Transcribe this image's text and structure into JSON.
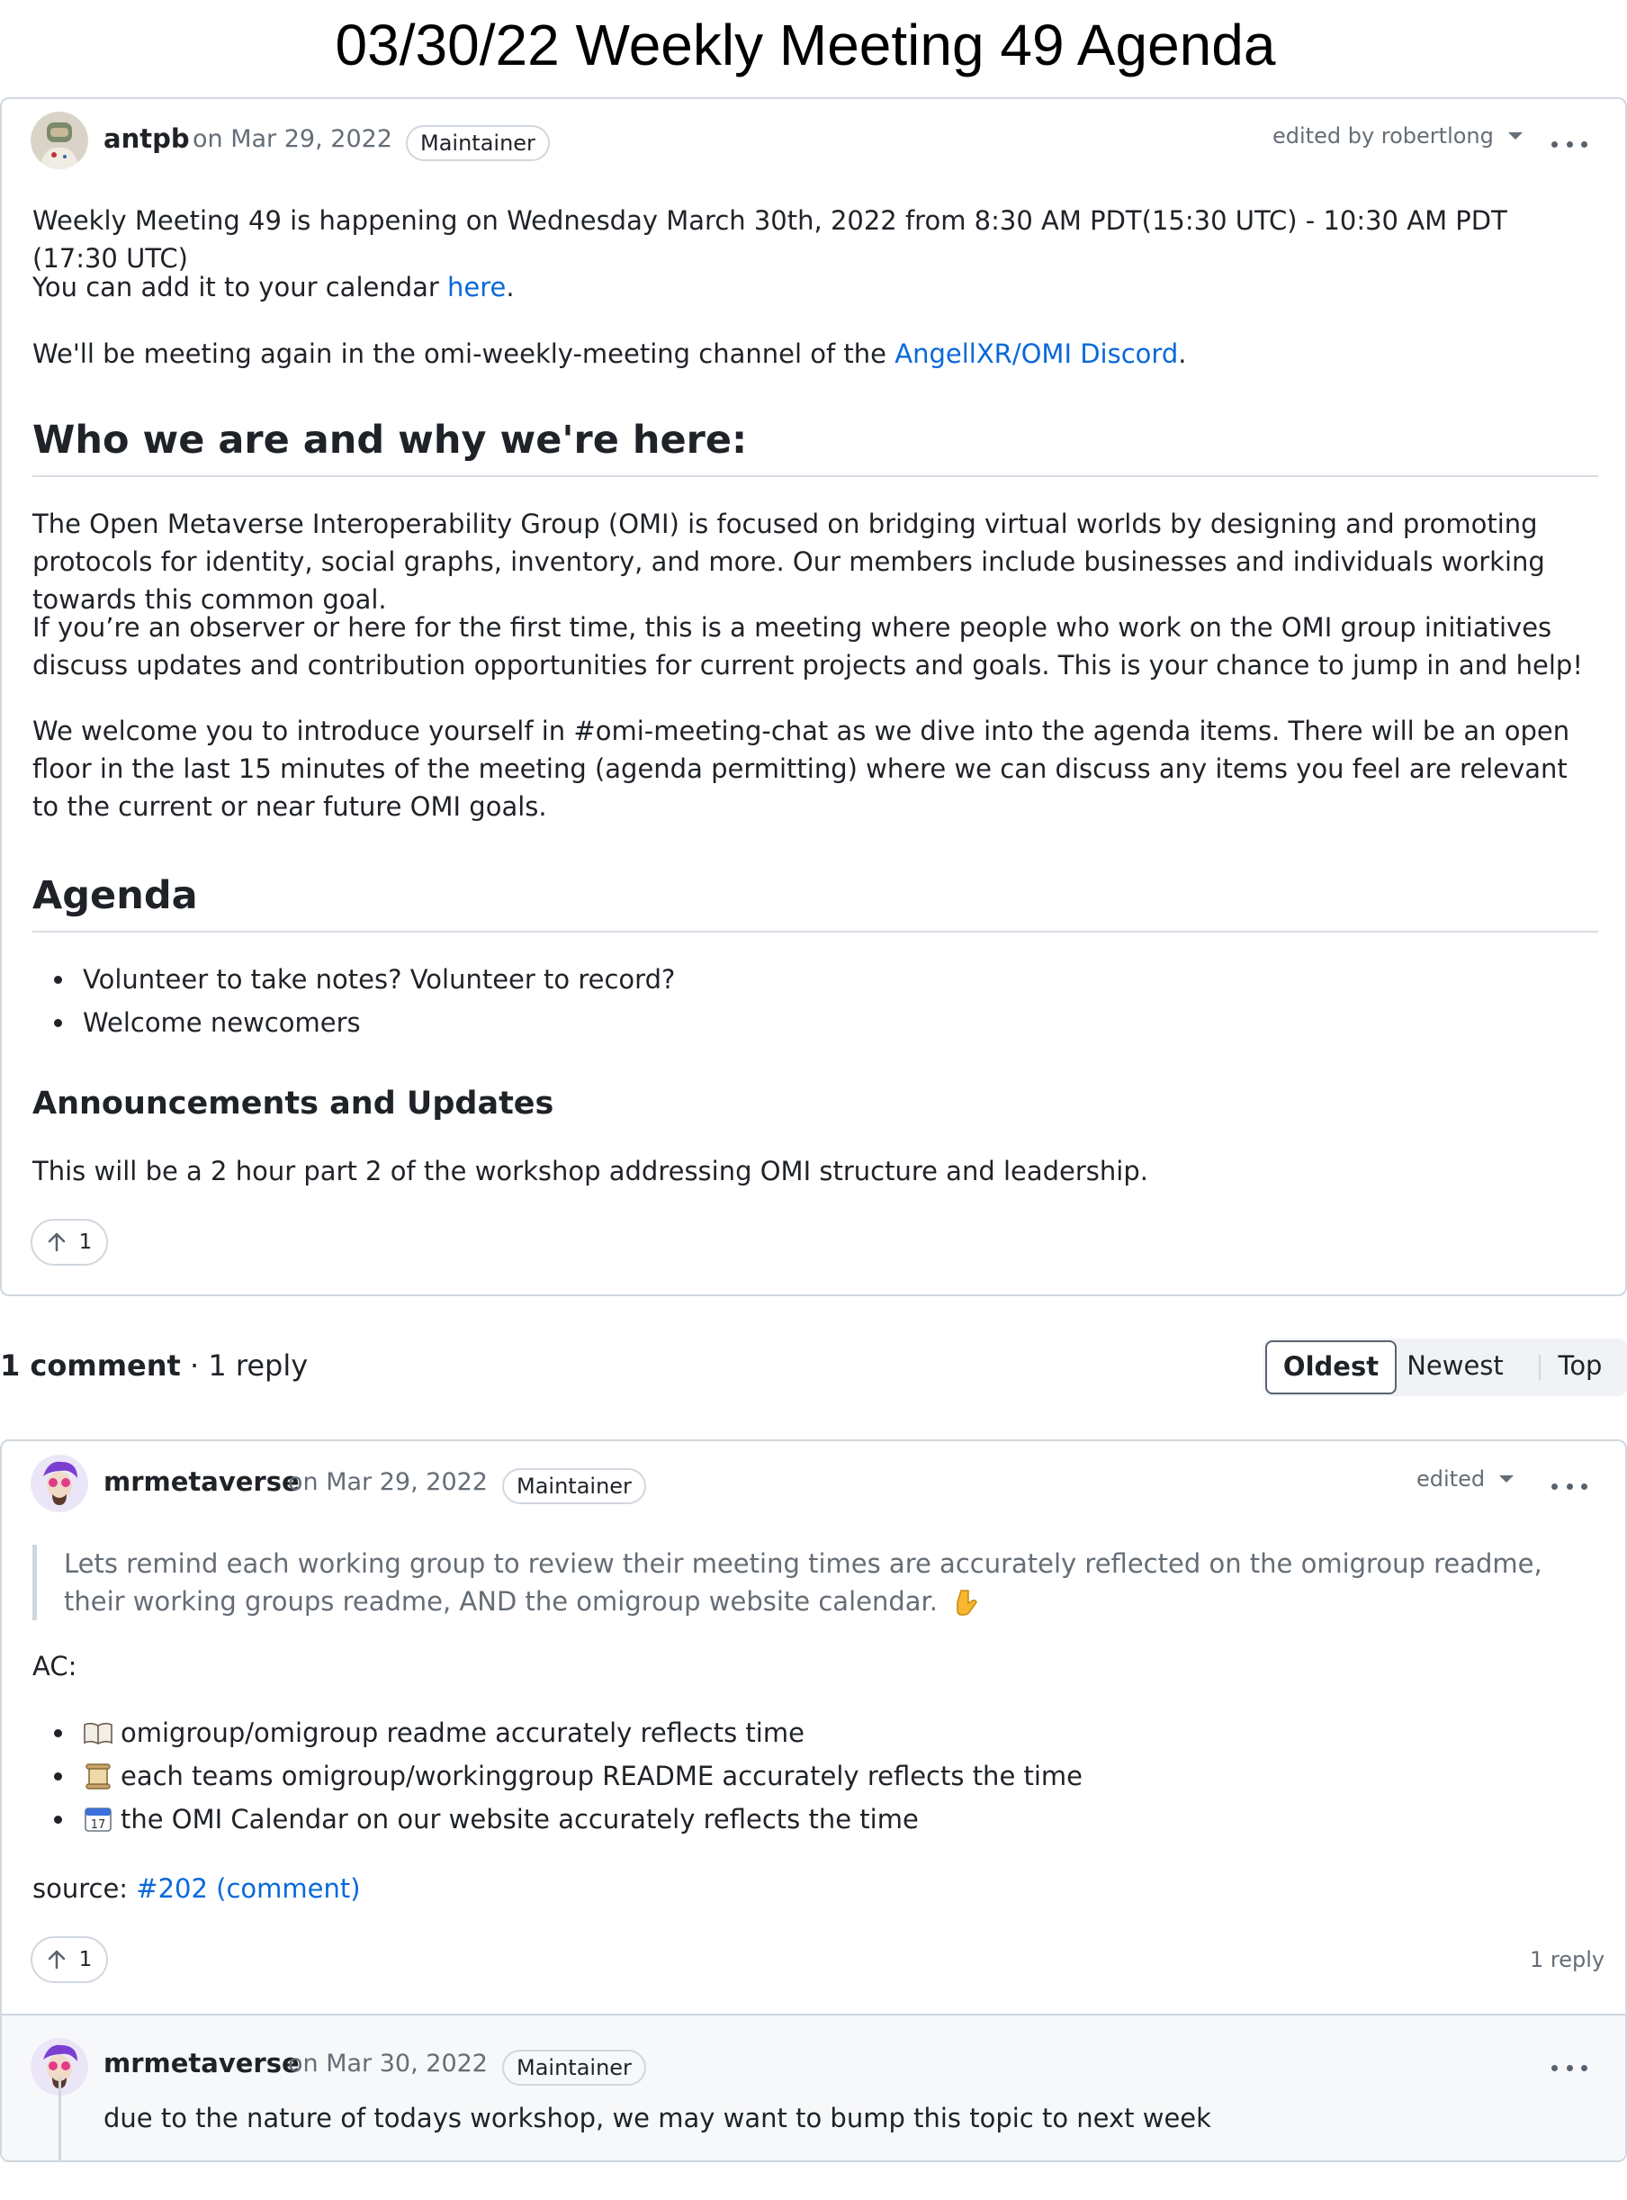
{
  "page": {
    "title": "03/30/22 Weekly Meeting 49 Agenda"
  },
  "post": {
    "author": "antpb",
    "date": "on Mar 29, 2022",
    "badge": "Maintainer",
    "edited_by": "edited by robertlong",
    "line1": "Weekly Meeting 49 is happening on Wednesday March 30th, 2022 from 8:30 AM PDT(15:30 UTC) - 10:30 AM PDT (17:30 UTC)",
    "calendar_prefix": "You can add it to your calendar ",
    "calendar_link": "here",
    "calendar_suffix": ".",
    "discord_prefix": "We'll be meeting again in the omi-weekly-meeting channel of the ",
    "discord_link": "AngellXR/OMI Discord",
    "discord_suffix": ".",
    "who_heading": "Who we are and why we're here:",
    "who_p1": "The Open Metaverse Interoperability Group (OMI) is focused on bridging virtual worlds by designing and promoting protocols for identity, social graphs, inventory, and more. Our members include businesses and individuals working towards this common goal.",
    "who_p2": "If you’re an observer or here for the first time, this is a meeting where people who work on the OMI group initiatives discuss updates and contribution opportunities for current projects and goals. This is your chance to jump in and help!",
    "who_p3": "We welcome you to introduce yourself in #omi-meeting-chat as we dive into the agenda items. There will be an open floor in the last 15 minutes of the meeting (agenda permitting) where we can discuss any items you feel are relevant to the current or near future OMI goals.",
    "agenda_heading": "Agenda",
    "agenda_items": [
      "Volunteer to take notes? Volunteer to record?",
      "Welcome newcomers"
    ],
    "announce_heading": "Announcements and Updates",
    "announce_text": "This will be a 2 hour part 2 of the workshop addressing OMI structure and leadership.",
    "votes": "1"
  },
  "comments_header": {
    "count": "1 comment",
    "sep": " · ",
    "replies": "1 reply"
  },
  "sort": {
    "oldest": "Oldest",
    "newest": "Newest",
    "top": "Top",
    "selected": "Oldest"
  },
  "comment": {
    "author": "mrmetaverse",
    "date": "on Mar 29, 2022",
    "badge": "Maintainer",
    "edited": "edited",
    "quote": "Lets remind each working group to review their meeting times are accurately reflected on the omigroup readme, their working groups readme, AND the omigroup website calendar.",
    "ac_label": "AC:",
    "ac_items": [
      {
        "icon": "book-emoji-icon",
        "text": "omigroup/omigroup readme accurately reflects time"
      },
      {
        "icon": "scroll-emoji-icon",
        "text": "each teams omigroup/workinggroup README accurately reflects the time"
      },
      {
        "icon": "calendar-emoji-icon",
        "text": "the OMI Calendar on our website accurately reflects the time"
      }
    ],
    "source_label": "source: ",
    "source_link": "#202 (comment)",
    "votes": "1",
    "reply_count": "1 reply"
  },
  "reply": {
    "author": "mrmetaverse",
    "date": "on Mar 30, 2022",
    "badge": "Maintainer",
    "text": "due to the nature of todays workshop, we may want to bump this topic to next week"
  }
}
